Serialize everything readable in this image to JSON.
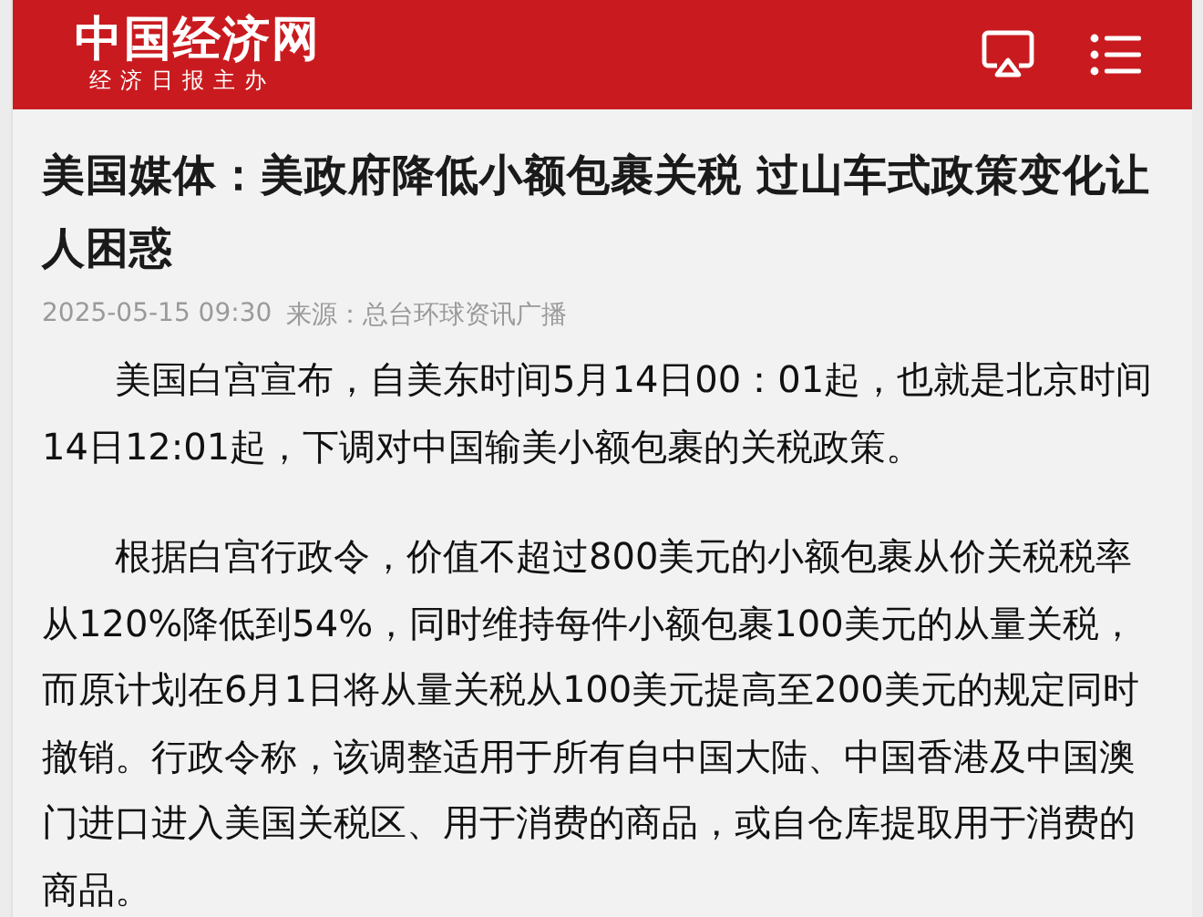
{
  "header": {
    "logo": "中国经济网",
    "tagline": "经济日报主办"
  },
  "article": {
    "title": "美国媒体：美政府降低小额包裹关税 过山车式政策变化让人困惑",
    "date": "2025-05-15 09:30",
    "source": "来源：总台环球资讯广播",
    "paragraphs": [
      "美国白宫宣布，自美东时间5月14日00：01起，也就是北京时间14日12:01起，下调对中国输美小额包裹的关税政策。",
      "根据白宫行政令，价值不超过800美元的小额包裹从价关税税率从120%降低到54%，同时维持每件小额包裹100美元的从量关税，而原计划在6月1日将从量关税从100美元提高至200美元的规定同时撤销。行政令称，该调整适用于所有自中国大陆、中国香港及中国澳门进口进入美国关税区、用于消费的商品，或自仓库提取用于消费的商品。"
    ]
  }
}
